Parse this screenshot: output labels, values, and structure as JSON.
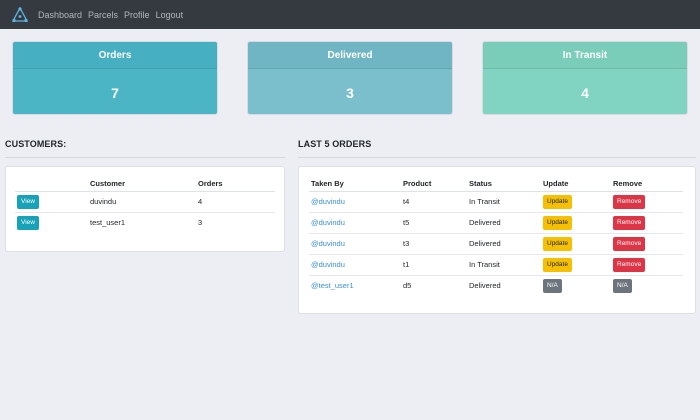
{
  "nav": {
    "links": [
      "Dashboard",
      "Parcels",
      "Profile",
      "Logout"
    ]
  },
  "stats": {
    "orders": {
      "label": "Orders",
      "value": "7"
    },
    "delivered": {
      "label": "Delivered",
      "value": "3"
    },
    "in_transit": {
      "label": "In Transit",
      "value": "4"
    }
  },
  "customers": {
    "title": "CUSTOMERS:",
    "headers": [
      "",
      "Customer",
      "Orders"
    ],
    "rows": [
      {
        "action": "View",
        "customer": "duvindu",
        "orders": "4"
      },
      {
        "action": "View",
        "customer": "test_user1",
        "orders": "3"
      }
    ]
  },
  "last_orders": {
    "title": "LAST 5 ORDERS",
    "headers": [
      "Taken By",
      "Product",
      "Status",
      "Update",
      "Remove"
    ],
    "rows": [
      {
        "taken_by": "@duvindu",
        "product": "t4",
        "status": "In Transit",
        "update": "Update",
        "remove": "Remove"
      },
      {
        "taken_by": "@duvindu",
        "product": "t5",
        "status": "Delivered",
        "update": "Update",
        "remove": "Remove"
      },
      {
        "taken_by": "@duvindu",
        "product": "t3",
        "status": "Delivered",
        "update": "Update",
        "remove": "Remove"
      },
      {
        "taken_by": "@duvindu",
        "product": "t1",
        "status": "In Transit",
        "update": "Update",
        "remove": "Remove"
      },
      {
        "taken_by": "@test_user1",
        "product": "d5",
        "status": "Delivered",
        "update": "N/A",
        "remove": "N/A"
      }
    ]
  },
  "colors": {
    "navbar": "#343a40",
    "info": "#17a2b8",
    "warning": "#f5c002",
    "danger": "#dc3545",
    "secondary": "#6c757d",
    "link": "#3a8ed6"
  }
}
